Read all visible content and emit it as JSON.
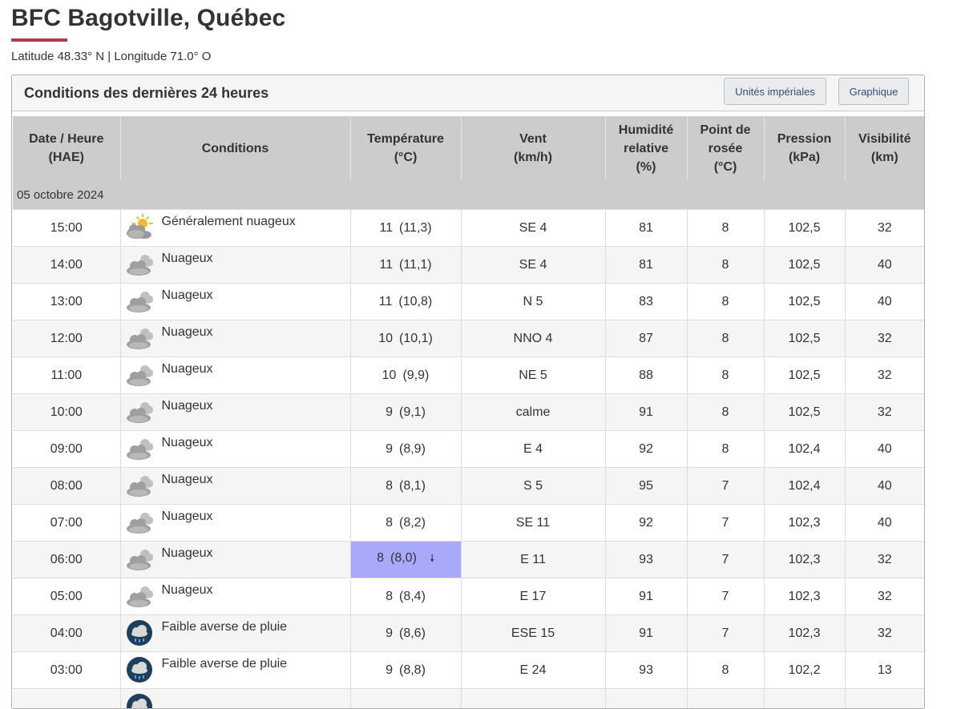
{
  "page": {
    "title": "BFC Bagotville, Québec",
    "coordinates": "Latitude 48.33° N | Longitude 71.0° O",
    "accent_color": "#af3c43"
  },
  "panel": {
    "title": "Conditions des dernières 24 heures",
    "imperial_button": "Unités impériales",
    "graph_button": "Graphique"
  },
  "table": {
    "headers": {
      "datetime": [
        "Date / Heure",
        "(HAE)"
      ],
      "conditions": [
        "Conditions"
      ],
      "temperature": [
        "Température",
        "(°C)"
      ],
      "wind": [
        "Vent",
        "(km/h)"
      ],
      "humidity": [
        "Humidité",
        "relative",
        "(%)"
      ],
      "dewpoint": [
        "Point de",
        "rosée",
        "(°C)"
      ],
      "pressure": [
        "Pression",
        "(kPa)"
      ],
      "visibility": [
        "Visibilité",
        "(km)"
      ]
    },
    "date_label": "05 octobre 2024",
    "rows": [
      {
        "time": "15:00",
        "icon": "mostly-cloudy-icon",
        "condition": "Généralement nuageux",
        "temp": "11",
        "temp_precise": "(11,3)",
        "wind": "SE 4",
        "humidity": "81",
        "dewpoint": "8",
        "pressure": "102,5",
        "visibility": "32"
      },
      {
        "time": "14:00",
        "icon": "cloudy-icon",
        "condition": "Nuageux",
        "temp": "11",
        "temp_precise": "(11,1)",
        "wind": "SE 4",
        "humidity": "81",
        "dewpoint": "8",
        "pressure": "102,5",
        "visibility": "40"
      },
      {
        "time": "13:00",
        "icon": "cloudy-icon",
        "condition": "Nuageux",
        "temp": "11",
        "temp_precise": "(10,8)",
        "wind": "N 5",
        "humidity": "83",
        "dewpoint": "8",
        "pressure": "102,5",
        "visibility": "40"
      },
      {
        "time": "12:00",
        "icon": "cloudy-icon",
        "condition": "Nuageux",
        "temp": "10",
        "temp_precise": "(10,1)",
        "wind": "NNO 4",
        "humidity": "87",
        "dewpoint": "8",
        "pressure": "102,5",
        "visibility": "32"
      },
      {
        "time": "11:00",
        "icon": "cloudy-icon",
        "condition": "Nuageux",
        "temp": "10",
        "temp_precise": "(9,9)",
        "wind": "NE 5",
        "humidity": "88",
        "dewpoint": "8",
        "pressure": "102,5",
        "visibility": "32"
      },
      {
        "time": "10:00",
        "icon": "cloudy-icon",
        "condition": "Nuageux",
        "temp": "9",
        "temp_precise": "(9,1)",
        "wind": "calme",
        "humidity": "91",
        "dewpoint": "8",
        "pressure": "102,5",
        "visibility": "32"
      },
      {
        "time": "09:00",
        "icon": "cloudy-icon",
        "condition": "Nuageux",
        "temp": "9",
        "temp_precise": "(8,9)",
        "wind": "E 4",
        "humidity": "92",
        "dewpoint": "8",
        "pressure": "102,4",
        "visibility": "40"
      },
      {
        "time": "08:00",
        "icon": "cloudy-icon",
        "condition": "Nuageux",
        "temp": "8",
        "temp_precise": "(8,1)",
        "wind": "S 5",
        "humidity": "95",
        "dewpoint": "7",
        "pressure": "102,4",
        "visibility": "40"
      },
      {
        "time": "07:00",
        "icon": "cloudy-icon",
        "condition": "Nuageux",
        "temp": "8",
        "temp_precise": "(8,2)",
        "wind": "SE 11",
        "humidity": "92",
        "dewpoint": "7",
        "pressure": "102,3",
        "visibility": "40"
      },
      {
        "time": "06:00",
        "icon": "cloudy-icon",
        "condition": "Nuageux",
        "temp": "8",
        "temp_precise": "(8,0)",
        "temp_marker": "🠗",
        "temp_highlight": "#a9a9fc",
        "wind": "E 11",
        "humidity": "93",
        "dewpoint": "7",
        "pressure": "102,3",
        "visibility": "32"
      },
      {
        "time": "05:00",
        "icon": "cloudy-icon",
        "condition": "Nuageux",
        "temp": "8",
        "temp_precise": "(8,4)",
        "wind": "E 17",
        "humidity": "91",
        "dewpoint": "7",
        "pressure": "102,3",
        "visibility": "32"
      },
      {
        "time": "04:00",
        "icon": "light-rain-shower-icon",
        "condition": "Faible averse de pluie",
        "temp": "9",
        "temp_precise": "(8,6)",
        "wind": "ESE 15",
        "humidity": "91",
        "dewpoint": "7",
        "pressure": "102,3",
        "visibility": "32"
      },
      {
        "time": "03:00",
        "icon": "light-rain-shower-icon",
        "condition": "Faible averse de pluie",
        "temp": "9",
        "temp_precise": "(8,8)",
        "wind": "E 24",
        "humidity": "93",
        "dewpoint": "8",
        "pressure": "102,2",
        "visibility": "13"
      },
      {
        "time": "",
        "icon": "light-rain-shower-icon",
        "condition": "",
        "temp": "",
        "temp_precise": "",
        "wind": "",
        "humidity": "",
        "dewpoint": "",
        "pressure": "",
        "visibility": ""
      }
    ]
  }
}
